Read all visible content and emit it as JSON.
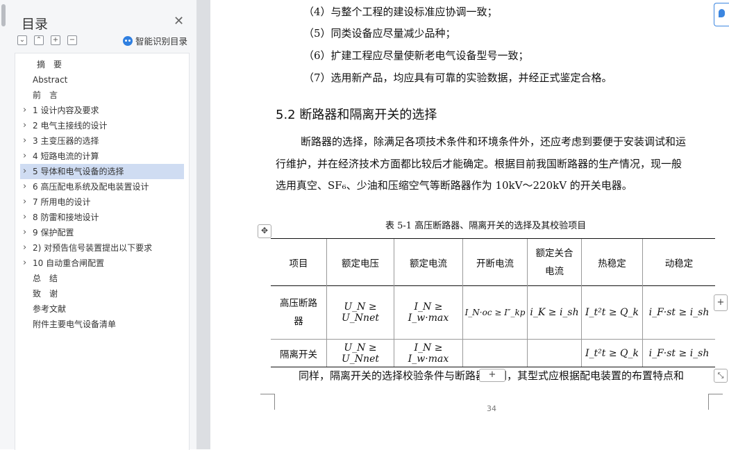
{
  "sidebar": {
    "title": "目录",
    "close_icon": "close-icon",
    "toolbar": {
      "collapse_all_icon": "collapse-all-icon",
      "expand_level_icon": "chevron-up-icon",
      "add_icon": "plus-icon",
      "remove_icon": "minus-icon"
    },
    "smart_toc_label": "智能识别目录",
    "items": [
      {
        "label": "摘　要",
        "expandable": false,
        "selected": false,
        "indent": 1
      },
      {
        "label": "Abstract",
        "expandable": false,
        "selected": false,
        "indent": 0
      },
      {
        "label": "前　言",
        "expandable": false,
        "selected": false,
        "indent": 0
      },
      {
        "label": "1 设计内容及要求",
        "expandable": true,
        "selected": false,
        "indent": 0
      },
      {
        "label": "2 电气主接线的设计",
        "expandable": true,
        "selected": false,
        "indent": 0
      },
      {
        "label": "3 主变压器的选择",
        "expandable": true,
        "selected": false,
        "indent": 0
      },
      {
        "label": "4 短路电流的计算",
        "expandable": true,
        "selected": false,
        "indent": 0
      },
      {
        "label": "5 导体和电气设备的选择",
        "expandable": true,
        "selected": true,
        "indent": 0
      },
      {
        "label": "6 高压配电系统及配电装置设计",
        "expandable": true,
        "selected": false,
        "indent": 0
      },
      {
        "label": "7 所用电的设计",
        "expandable": true,
        "selected": false,
        "indent": 0
      },
      {
        "label": "8 防雷和接地设计",
        "expandable": true,
        "selected": false,
        "indent": 0
      },
      {
        "label": "9 保护配置",
        "expandable": true,
        "selected": false,
        "indent": 0
      },
      {
        "label": "2) 对预告信号装置提出以下要求",
        "expandable": true,
        "selected": false,
        "indent": 0
      },
      {
        "label": "10 自动重合闸配置",
        "expandable": true,
        "selected": false,
        "indent": 0
      },
      {
        "label": "总　结",
        "expandable": false,
        "selected": false,
        "indent": 0
      },
      {
        "label": "致　谢",
        "expandable": false,
        "selected": false,
        "indent": 0
      },
      {
        "label": "参考文献",
        "expandable": false,
        "selected": false,
        "indent": 0
      },
      {
        "label": "附件主要电气设备清单",
        "expandable": false,
        "selected": false,
        "indent": 0
      }
    ]
  },
  "document": {
    "list_lines": [
      "（4）与整个工程的建设标准应协调一致；",
      "（5）同类设备应尽量减少品种；",
      "（6）扩建工程应尽量使新老电气设备型号一致；",
      "（7）选用新产品，均应具有可靠的实验数据，并经正式鉴定合格。"
    ],
    "section_heading": "5.2  断路器和隔离开关的选择",
    "paragraph_lines": [
      "断路器的选择，除满足各项技术条件和环境条件外，还应考虑到要便于安装调试和运",
      "行维护，并在经济技术方面都比较后才能确定。根据目前我国断路器的生产情况，现一般",
      "选用真空、SF₆、少油和压缩空气等断路器作为 10kV～220kV 的开关电器。"
    ],
    "table_caption": "表 5-1  高压断路器、隔离开关的选择及其校验项目",
    "table": {
      "headers": [
        "项目",
        "额定电压",
        "额定电流",
        "开断电流",
        "额定关合电流",
        "热稳定",
        "动稳定"
      ],
      "rows": [
        [
          "高压断路器",
          "U_N ≥ U_Nnet",
          "I_N ≥ I_w·max",
          "I_N·oc ≥ I″_kp",
          "i_K ≥ i_sh",
          "I_t²t ≥ Q_k",
          "i_F·st ≥ i_sh"
        ],
        [
          "隔离开关",
          "U_N ≥ U_Nnet",
          "I_N ≥ I_w·max",
          "",
          "",
          "I_t²t ≥ Q_k",
          "i_F·st ≥ i_sh"
        ]
      ]
    },
    "trailing_line": "同样，隔离开关的选择校验条件与断路器相同，其型式应根据配电装置的布置特点和",
    "page_number": "34"
  }
}
